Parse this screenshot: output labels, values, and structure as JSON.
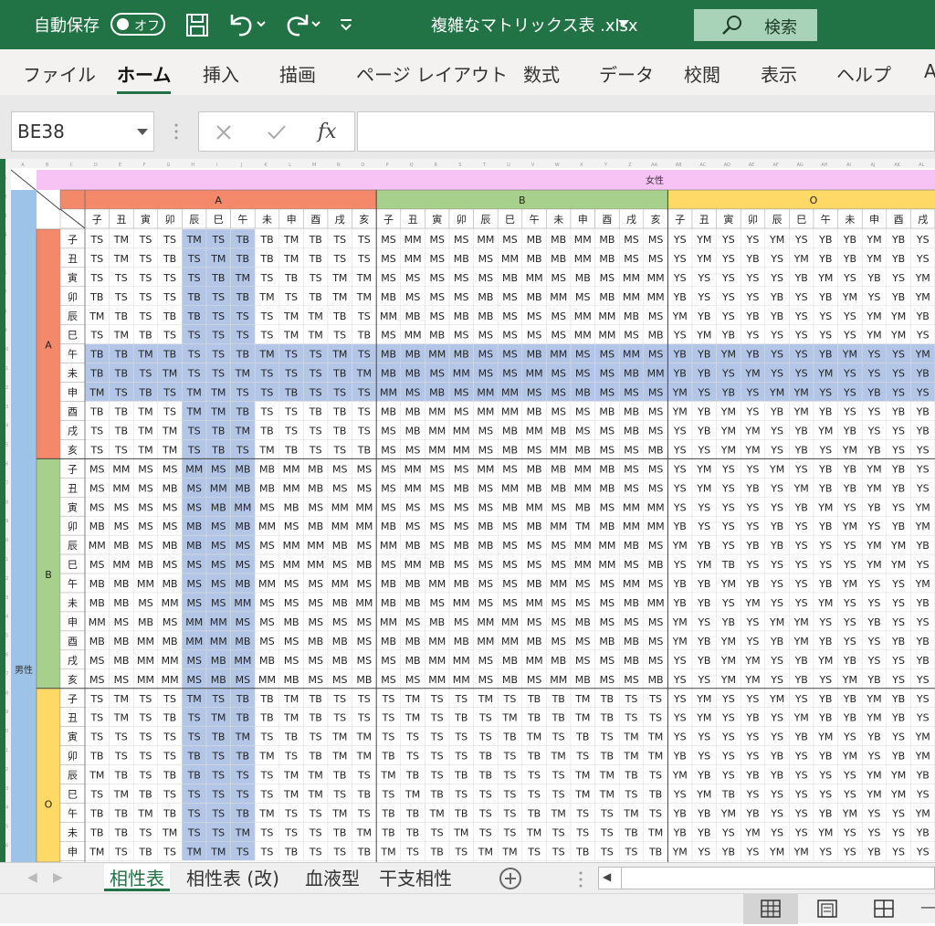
{
  "titlebar": {
    "autosave_label": "自動保存",
    "autosave_state": "オフ",
    "filename": "複雑なマトリックス表 .xlsx",
    "search_label": "検索"
  },
  "ribbon": {
    "tabs": [
      "ファイル",
      "ホーム",
      "挿入",
      "描画",
      "ページ レイアウト",
      "数式",
      "データ",
      "校閲",
      "表示",
      "ヘルプ",
      "A"
    ],
    "active_tab": "ホーム"
  },
  "formula_bar": {
    "name_box": "BE38",
    "fx_label": "fx",
    "formula": ""
  },
  "sheet": {
    "col_letters": [
      "A",
      "B",
      "C",
      "D",
      "E",
      "F",
      "G",
      "H",
      "I",
      "J",
      "K",
      "L",
      "M",
      "N",
      "O",
      "P",
      "Q",
      "R",
      "S",
      "T",
      "U",
      "V",
      "W",
      "X",
      "Y",
      "Z",
      "AA",
      "AB",
      "AC",
      "AD",
      "AE",
      "AF",
      "AG",
      "AH",
      "AI",
      "AJ",
      "AK",
      "AL"
    ],
    "female_label": "女性",
    "male_label": "男性",
    "groups": [
      "A",
      "B",
      "O"
    ],
    "zodiac": [
      "子",
      "丑",
      "寅",
      "卯",
      "辰",
      "巳",
      "午",
      "未",
      "申",
      "酉",
      "戌",
      "亥"
    ],
    "colors": {
      "female": "#f7c3f4",
      "group_A": "#f3896a",
      "group_B": "#a8d08d",
      "group_O": "#ffd966",
      "male": "#9dc3e6",
      "highlight": "#b4c6e7"
    },
    "blocks": {
      "A-A": [
        "TS TM TS TS TM TS TB TB TM TB TS TS",
        "TS TM TS TB TS TM TB TB TM TB TS TS",
        "TS TS TS TS TS TB TM TS TB TS TM TM",
        "TB TS TS TS TB TS TB TM TS TB TM TM",
        "TM TB TS TB TB TS TS TS TM TM TB TS",
        "TS TM TB TS TS TS TS TS TM TM TS TB",
        "TB TB TM TB TS TS TB TM TS TS TM TS",
        "TB TB TS TM TS TS TM TS TS TS TB TM",
        "TM TS TB TS TM TM TS TS TB TS TS TS",
        "TB TB TM TS TM TM TB TS TS TB TB TS",
        "TS TB TM TM TS TB TM TB TS TS TB TS",
        "TS TS TM TM TS TB TS TM TB TS TS TB"
      ],
      "A-B": [
        "MS MM MS MS MM MS MB MB MM MB MS MS",
        "MS MM MS MB MS MM MB MB MM MB MS MS",
        "MS MS MS MS MS MB MM MS MB MS MM MM",
        "MB MS MS MS MB MS MB MM MS MB MM MM",
        "MM MB MS MB MB MS MS MS MM MM MB MS",
        "MS MM MB MS MS MS MS MS MM MM MS MB",
        "MB MB MM MB MS MS MB MM MS MS MM MS",
        "MB MB MS MM MS MS MM MS MS MS MB MM",
        "MM MS MB MS MM MM MS MS MB MS MS MS",
        "MB MB MM MS MM MM MB MS MS MB MB MS",
        "MS MB MM MM MS MB MM MB MS MS MB MS",
        "MS MS MM MM MS MB MS MM MB MS MS MB"
      ],
      "A-O": [
        "YS YM YS YS YM YS YB YB YM YB YS YS",
        "YS YM YS YB YS YM YB YB YM YB YS YS",
        "YS YS YS YS YS YB YM YS YB YS YM YM",
        "YB YS YS YS YB YS YB YM YS YB YM YM",
        "YM YB YS YB YB YS YS YS YM YM YB YS",
        "YS YM YB YS YS YS YS YS YM YM YS YB",
        "YB YB YM YB YS YS YB YM YS YS YM YS",
        "YB YB YS YM YS YS YM YS YS YS YB YM",
        "YM YS YB YS YM YM YS YS YB YS YS YS",
        "YM YB YM YS YB YM YB YS YS YB YB YS",
        "YS YB YM YM YS YB YM YB YS YS YB YS",
        "YS YS YM YM YS YB YS YM YB YS YS YB"
      ],
      "B-A": [
        "MS MM MS MS MM MS MB MB MM MB MS MS",
        "MS MM MS MB MS MM MB MB MM MB MS MS",
        "MS MS MS MS MS MB MM MS MB MS MM MM",
        "MB MS MS MS MB MS MB MM MS MB MM MM",
        "MM MB MS MB MB MS MS MS MM MM MB MS",
        "MS MM MB MS MS MS MS MS MM MM MS MB",
        "MB MB MM MB MS MS MB MM MS MS MM MS",
        "MB MB MS MM MS MS MM MS MS MS MB MM",
        "MM MS MB MS MM MM MS MS MB MS MS MS",
        "MB MB MM MB MM MM MB MS MS MB MB MS",
        "MS MB MM MM MS MB MM MB MS MS MB MS",
        "MS MS MM MM MS MB MS MM MB MS MS MB"
      ],
      "B-B": [
        "MS MM MS MS MM MS MB MB MM MB MS MS",
        "MS MM MS MB MS MM MB MB MM MB MS MS",
        "MS MS MS MS MS MB MM MS MB MS MM MM",
        "MB MS MS MS MB MS MB MM TM MB MM MM",
        "MM MB MS MB MB MS MS MS MM MM MB MS",
        "MS MM MB MS MS MS MS MS MM MM MS MB",
        "MB MB MM MB MS MS MB MM MS MS MM MS",
        "MB MB MS MM MS MS MM MS MS MS MB MM",
        "MM MS MB MS MM MM MS MS MB MS MS MS",
        "MB MB MM MB MM MM MB MS MS MB MB MS",
        "MS MB MM MM MS MB MM MB MS MS MB MS",
        "MS MS MM MM MS MB MS MM MB MS MS MB"
      ],
      "B-O": [
        "YS YM YS YS YM YS YB YB YM YB YS YS",
        "YS YM YS YB YS YM YB YB YM YB YS YS",
        "YS YS YS YS YS YB YM YS YB YS YM YM",
        "YB YS YS YS YB YS YB YM YS YB YM YM",
        "YM YB YS YB YB YS YS YS YM YM YB YS",
        "YS YM TB YS YS YS YS YS YM YM YS YB",
        "YB YB YM YB YS YS YB YM YS YS YM YS",
        "YB YB YS YM YS YS YM YS YS YS YB YM",
        "YM YS YB YS YM YM YS YS YB YS YS YS",
        "YM YB YM YS YB YM YB YS YS YB YB YS",
        "YS YB YM YM YS YB YM YB YS YS YB YS",
        "YS YS YM YM YS YB YS YM YB YS YS YB"
      ],
      "O-A": [
        "TS TM TS TS TM TS TB TB TM TB TS TS",
        "TS TM TS TB TS TM TB TB TM TB TS TS",
        "TS TS TS TS TS TB TM TS TB TS TM TM",
        "TB TS TS TS TB TS TB TM TS TB TM TM",
        "TM TB TS TB TB TS TS TS TM TM TB TS",
        "TS TM TB TS TS TS TS TS TM TM TS TB",
        "TB TB TM TB TS TS TB TM TS TS TM TS",
        "TB TB TS TM TS TS TM TS TS TS TB TM",
        "TM TS TB TS TM TM TS TS TB TS TS TB"
      ],
      "O-B": [
        "TS TM TS TS TM TS TB TB TM TB TS TS",
        "TS TM TS TB TS TM TB TB TM TB TS TS",
        "TS TS TS TS TS TB TM TS TB TS TM TM",
        "TB TS TS TS TB TS TB TM TS TB TM TM",
        "TM TB TS TB TB TS TS TS TM TM TB TS",
        "TS TM TB TS TS TS TS TS TM TM TS TB",
        "TB TB TM TB TS TS TB TM TS TS TM TS",
        "TB TB TS TM TS TS TM TS TS TS TB TM",
        "TM TS TB TS TM TM TS TS TB TS TS TB"
      ],
      "O-O": [
        "YS YM YS YS YM YS YB YB YM YB YS YS",
        "YS YM YS YB YS YM YB YB YM YB YS YS",
        "YS YS YS YS YS YB YM YS YB YS YM YM",
        "YB YS YS YS YB YS YB YM YS YB YM YM",
        "YM YB YS YB YB YS YS YS YM YM YB YS",
        "YS YM TB YS YS YS YS YS YM YM YS YB",
        "YB YB YM YB YS YS YB YM YS YS YM YS",
        "YB YB YS YM YS YS YM YS YS YS YB YM",
        "YM YS YB YS YM YM YS YS YB YS YS YS"
      ]
    }
  },
  "sheet_tabs": [
    "相性表",
    "相性表 (改)",
    "血液型",
    "干支相性"
  ],
  "active_sheet": "相性表",
  "status": {
    "views": [
      "normal-view",
      "page-layout-view",
      "page-break-view"
    ],
    "active_view": "normal-view"
  }
}
